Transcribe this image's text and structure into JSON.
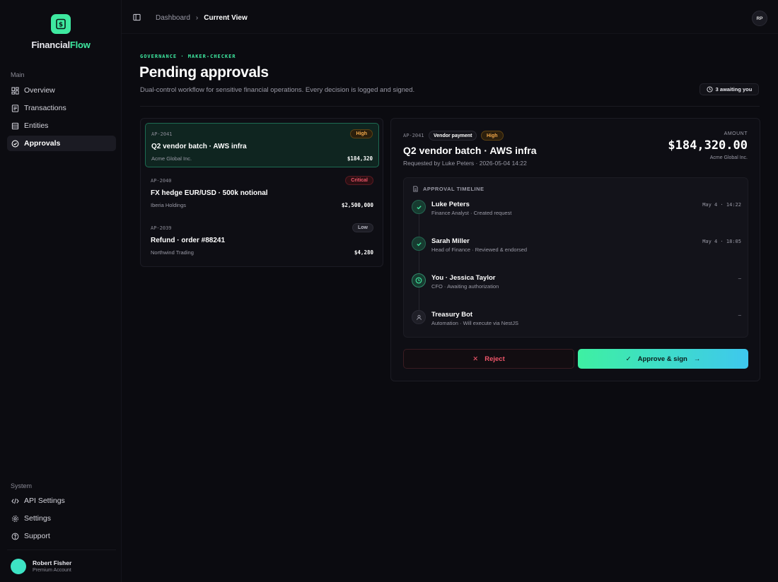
{
  "app": {
    "name_part1": "Financial",
    "name_part2": "Flow",
    "accent_color": "#3ee9a0"
  },
  "sidebar": {
    "main_label": "Main",
    "main_items": [
      {
        "label": "Overview",
        "icon": "grid-icon"
      },
      {
        "label": "Transactions",
        "icon": "receipt-icon"
      },
      {
        "label": "Entities",
        "icon": "database-icon"
      },
      {
        "label": "Approvals",
        "icon": "check-circle-icon",
        "active": true
      }
    ],
    "system_label": "System",
    "system_items": [
      {
        "label": "API Settings",
        "icon": "code-icon"
      },
      {
        "label": "Settings",
        "icon": "gear-icon"
      },
      {
        "label": "Support",
        "icon": "help-circle-icon"
      }
    ],
    "user": {
      "name": "Robert Fisher",
      "plan": "Premium Account"
    }
  },
  "topbar": {
    "breadcrumb": [
      "Dashboard",
      "Current View"
    ],
    "avatar_initials": "RP"
  },
  "header": {
    "eyebrow": "GOVERNANCE · MAKER-CHECKER",
    "title": "Pending approvals",
    "subtitle": "Dual-control workflow for sensitive financial operations. Every decision is logged and signed.",
    "awaiting": "3 awaiting you"
  },
  "requests": [
    {
      "id": "AP-2041",
      "title": "Q2 vendor batch · AWS infra",
      "entity": "Acme Global Inc.",
      "amount": "$184,320",
      "priority": "High"
    },
    {
      "id": "AP-2040",
      "title": "FX hedge EUR/USD · 500k notional",
      "entity": "Iberia Holdings",
      "amount": "$2,500,000",
      "priority": "Critical"
    },
    {
      "id": "AP-2039",
      "title": "Refund · order #88241",
      "entity": "Northwind Trading",
      "amount": "$4,280",
      "priority": "Low"
    }
  ],
  "detail": {
    "id": "AP-2041",
    "type": "Vendor payment",
    "priority": "High",
    "title": "Q2 vendor batch · AWS infra",
    "requested_by": "Requested by Luke Peters · 2026-05-04 14:22",
    "amount_label": "AMOUNT",
    "amount": "$184,320.00",
    "entity": "Acme Global Inc.",
    "timeline_title": "APPROVAL TIMELINE",
    "steps": [
      {
        "name": "Luke Peters",
        "role": "Finance Analyst · Created request",
        "time": "May 4 · 14:22",
        "status": "done"
      },
      {
        "name": "Sarah Miller",
        "role": "Head of Finance · Reviewed & endorsed",
        "time": "May 4 · 18:05",
        "status": "done"
      },
      {
        "name": "You · Jessica Taylor",
        "role": "CFO · Awaiting authorization",
        "time": "—",
        "status": "current"
      },
      {
        "name": "Treasury Bot",
        "role": "Automation · Will execute via NestJS",
        "time": "—",
        "status": "pending"
      }
    ],
    "reject_label": "Reject",
    "approve_label": "Approve & sign"
  }
}
